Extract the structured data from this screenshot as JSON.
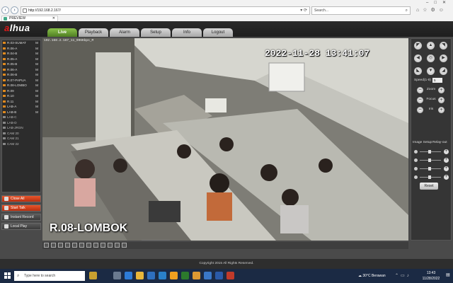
{
  "browser": {
    "address": "http://192.168.2.167/",
    "search_placeholder": "Search...",
    "tab_title": "PREVIEW"
  },
  "app": {
    "logo_prefix": "a",
    "logo_brand": "lhua",
    "nav": [
      "Live",
      "Playback",
      "Alarm",
      "Setup",
      "Info",
      "Logout"
    ],
    "active_nav": "Live",
    "cameras": [
      {
        "label": "R.03-SUMAT",
        "mark": "M"
      },
      {
        "label": "R.06-A",
        "mark": "M"
      },
      {
        "label": "R.04-B",
        "mark": "M"
      },
      {
        "label": "R.05-A",
        "mark": "M"
      },
      {
        "label": "R.05-B",
        "mark": "M"
      },
      {
        "label": "R.06-A",
        "mark": "M"
      },
      {
        "label": "R.06-B",
        "mark": "M"
      },
      {
        "label": "R.07-PAPUA",
        "mark": "M"
      },
      {
        "label": "R.08-LOMBO",
        "mark": "M"
      },
      {
        "label": "R.09",
        "mark": "M"
      },
      {
        "label": "R.10",
        "mark": "M"
      },
      {
        "label": "R.11",
        "mark": "M"
      },
      {
        "label": "LAB-A",
        "mark": "M"
      },
      {
        "label": "LAB-B",
        "mark": "M"
      },
      {
        "label": "LAB-C",
        "mark": ""
      },
      {
        "label": "LAB-D",
        "mark": ""
      },
      {
        "label": "LAB-JRGN",
        "mark": ""
      },
      {
        "label": "CAM 20",
        "mark": ""
      },
      {
        "label": "CAM 21",
        "mark": ""
      },
      {
        "label": "CAM 22",
        "mark": ""
      }
    ],
    "controls": {
      "close_all": "Close All",
      "start_talk": "Start Talk",
      "instant_record": "Instant Record",
      "local_play": "Local Play"
    },
    "video": {
      "stream_label": "192.168.2.167_11_996Kbps_M",
      "osd_datetime": "2022-11-28 13:41:07",
      "osd_camera": "R.08-LOMBOK"
    },
    "ptz": {
      "speed_label": "Speed(1-8)",
      "speed_value": "5",
      "zoom": "Zoom",
      "focus": "Focus",
      "iris": "Iris"
    },
    "image_setup": "Image Setup",
    "relay_out": "Relay-out",
    "reset": "Reset",
    "footer": "Copyright 2015 All Rights Reserved."
  },
  "taskbar": {
    "search_placeholder": "Type here to search",
    "weather": "30°C  Berawan",
    "time": "13:43",
    "date": "11/28/2022"
  }
}
